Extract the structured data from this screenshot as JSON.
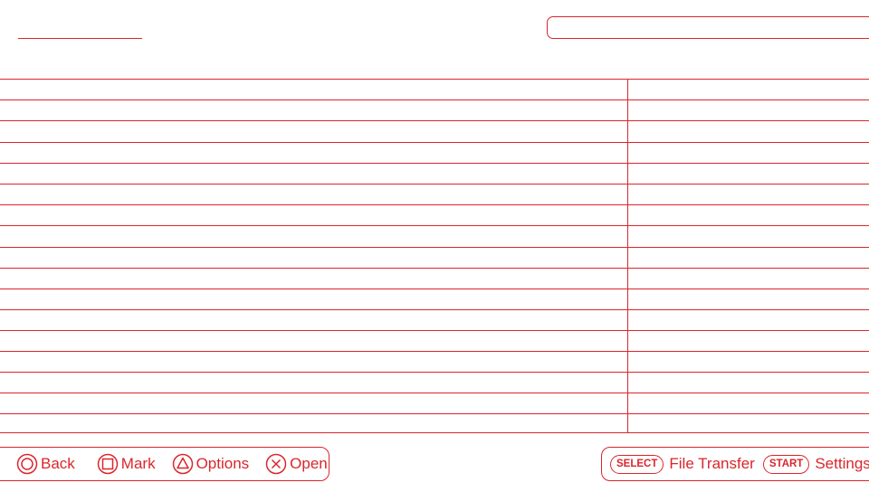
{
  "header": {
    "title": "",
    "path": ""
  },
  "file_list": {
    "rows": [
      "",
      "",
      "",
      "",
      "",
      "",
      "",
      "",
      "",
      "",
      "",
      "",
      "",
      "",
      "",
      "",
      ""
    ]
  },
  "hints": {
    "left": [
      {
        "icon": "circle-button-icon",
        "label": "Back"
      },
      {
        "icon": "square-button-icon",
        "label": "Mark"
      },
      {
        "icon": "triangle-button-icon",
        "label": "Options"
      },
      {
        "icon": "cross-button-icon",
        "label": "Open"
      }
    ],
    "right": [
      {
        "key": "SELECT",
        "label": "File Transfer"
      },
      {
        "key": "START",
        "label": "Settings"
      }
    ]
  },
  "colors": {
    "accent": "#d9262c",
    "background": "#ffffff"
  }
}
